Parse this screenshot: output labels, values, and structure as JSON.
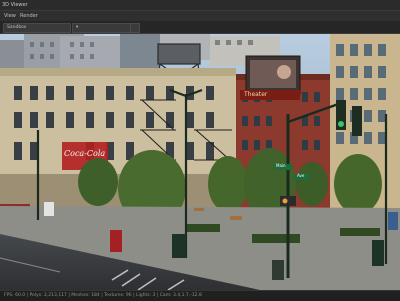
{
  "window": {
    "title": "3D Viewer"
  },
  "menu": {
    "items": [
      "View",
      "Render"
    ]
  },
  "toolbar": {
    "mode_dropdown": "Sandbox"
  },
  "scene": {
    "cocacola_sign": "Coca-Cola",
    "theatre_sign": "Theater",
    "street_sign_1": "Main",
    "street_sign_2": "Ave"
  },
  "status": {
    "text": "FPS: 60.0 | Polys: 2,213,117 | Meshes: 184 | Textures: 96 | Lights: 3 | Cam: 3.4,1.7,-12.8"
  }
}
